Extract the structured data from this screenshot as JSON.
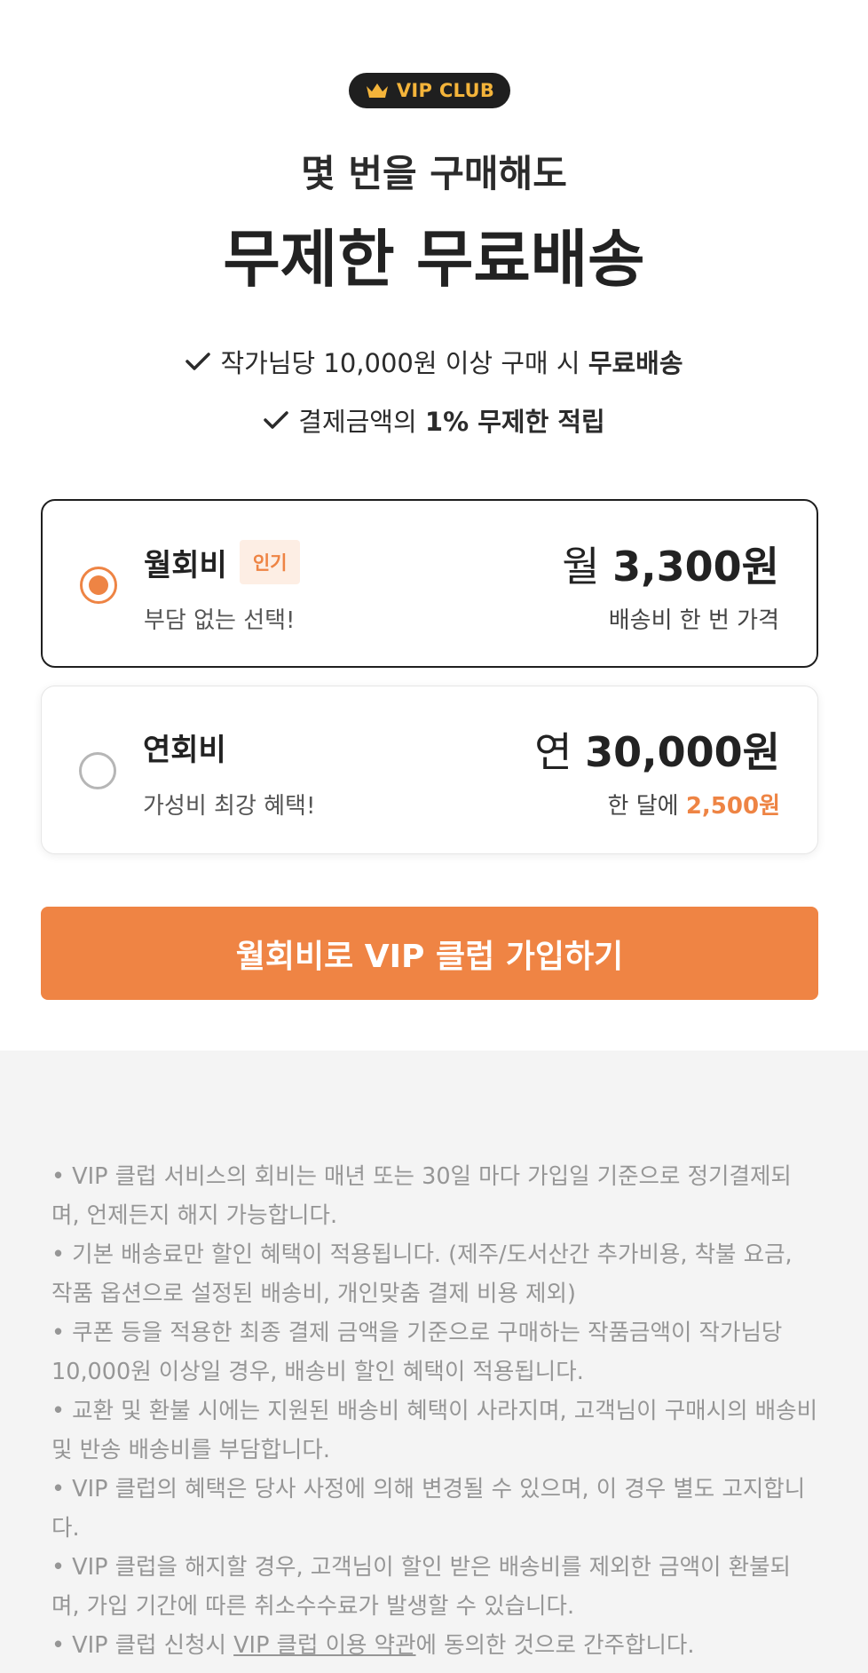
{
  "header": {
    "badge": "VIP CLUB",
    "subtitle": "몇 번을 구매해도",
    "title": "무제한 무료배송"
  },
  "benefits": [
    {
      "text": "작가님당 10,000원 이상 구매 시 ",
      "bold": "무료배송",
      "after": ""
    },
    {
      "text": "결제금액의 ",
      "bold": "1% 무제한 적립",
      "after": ""
    }
  ],
  "plans": {
    "monthly": {
      "name": "월회비",
      "tag": "인기",
      "desc": "부담 없는 선택!",
      "price_prefix": "월 ",
      "price": "3,300원",
      "note": "배송비 한 번 가격",
      "selected": true
    },
    "yearly": {
      "name": "연회비",
      "desc": "가성비 최강 혜택!",
      "price_prefix": "연 ",
      "price": "30,000원",
      "note_prefix": "한 달에 ",
      "note_highlight": "2,500원",
      "selected": false
    }
  },
  "cta": {
    "label": "월회비로 VIP 클럽 가입하기"
  },
  "notes": {
    "items": [
      "• VIP 클럽 서비스의 회비는 매년 또는 30일 마다 가입일 기준으로 정기결제되며, 언제든지 해지 가능합니다.",
      "• 기본 배송료만 할인 혜택이 적용됩니다. (제주/도서산간 추가비용, 착불 요금, 작품 옵션으로 설정된 배송비, 개인맞춤 결제 비용 제외)",
      "• 쿠폰 등을 적용한 최종 결제 금액을 기준으로 구매하는 작품금액이 작가님당 10,000원 이상일 경우, 배송비 할인 혜택이 적용됩니다.",
      "• 교환 및 환불 시에는 지원된 배송비 혜택이 사라지며, 고객님이 구매시의 배송비 및 반송 배송비를 부담합니다.",
      "• VIP 클럽의 혜택은 당사 사정에 의해 변경될 수 있으며, 이 경우 별도 고지합니다.",
      "• VIP 클럽을 해지할 경우, 고객님이 할인 받은 배송비를 제외한 금액이 환불되며, 가입 기간에 따른 취소수수료가 발생할 수 있습니다."
    ],
    "last_prefix": "• VIP 클럽 신청시 ",
    "last_link": "VIP 클럽 이용 약관",
    "last_suffix": "에 동의한 것으로 간주합니다."
  },
  "colors": {
    "accent": "#ee8444",
    "badge_bg": "#1f1f1f",
    "badge_text": "#f4b43a",
    "notes_bg": "#f4f4f4"
  }
}
